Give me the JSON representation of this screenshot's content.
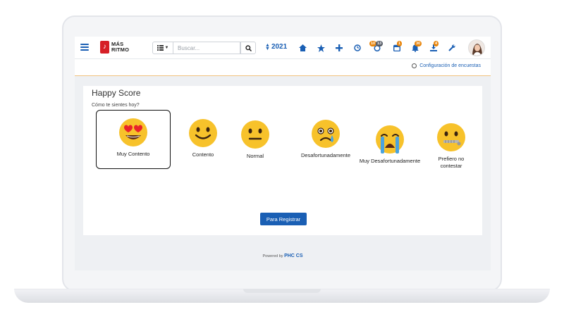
{
  "header": {
    "logo_line1": "MÁS",
    "logo_line2": "RITMO",
    "search_placeholder": "Buscar...",
    "year": "2021",
    "badges": {
      "clock": "10",
      "clock2": "13",
      "calendar": "1",
      "bell": "30",
      "download": "4"
    }
  },
  "subbar": {
    "config_label": "Configuración de encuestas"
  },
  "survey": {
    "title": "Happy Score",
    "question": "Cómo te sientes hoy?",
    "options": [
      {
        "label": "Muy Contento",
        "selected": true
      },
      {
        "label": "Contento"
      },
      {
        "label": "Normal"
      },
      {
        "label": "Desafortunadamente"
      },
      {
        "label": "Muy Desafortunadamente"
      },
      {
        "label": "Prefiero no contestar"
      }
    ],
    "submit_label": "Para Registrar"
  },
  "footer": {
    "powered_by": "Powered by",
    "brand": "PHC CS"
  },
  "colors": {
    "accent": "#1a5fb4",
    "badge": "#e8850c",
    "emoji": "#f7c22b"
  }
}
